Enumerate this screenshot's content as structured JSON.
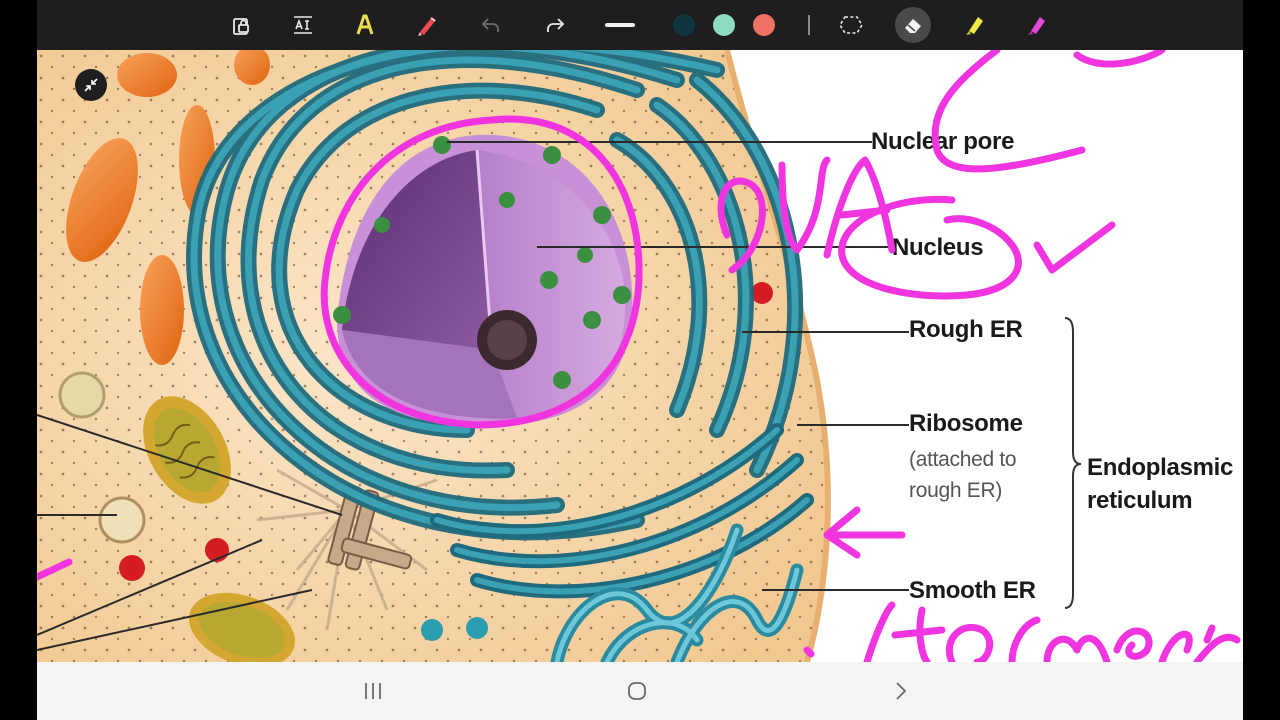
{
  "toolbar": {
    "tools": [
      {
        "name": "lock-icon",
        "label": ""
      },
      {
        "name": "text-tool-icon",
        "label": ""
      },
      {
        "name": "highlighter-text-icon",
        "label": ""
      },
      {
        "name": "pen-icon",
        "label": ""
      },
      {
        "name": "undo-icon",
        "label": ""
      },
      {
        "name": "redo-icon",
        "label": ""
      },
      {
        "name": "stroke-width-icon",
        "label": ""
      },
      {
        "name": "lasso-icon",
        "label": ""
      },
      {
        "name": "eraser-icon",
        "label": "",
        "active": true
      },
      {
        "name": "highlighter-yellow-icon",
        "label": ""
      },
      {
        "name": "highlighter-pink-icon",
        "label": ""
      }
    ],
    "colors": [
      "#12363f",
      "#8fdcc2",
      "#ef7163"
    ]
  },
  "diagram": {
    "labels": {
      "nuclear_pore": "Nuclear pore",
      "nucleus": "Nucleus",
      "rough_er": "Rough ER",
      "ribosome": "Ribosome",
      "ribosome_note_1": "(attached to",
      "ribosome_note_2": "rough ER)",
      "endoplasmic_1": "Endoplasmic",
      "endoplasmic_2": "reticulum",
      "smooth_er": "Smooth ER"
    },
    "ink_color": "#f035e0"
  },
  "navbar": {
    "items": [
      "recent-apps-icon",
      "home-icon",
      "back-icon"
    ]
  }
}
